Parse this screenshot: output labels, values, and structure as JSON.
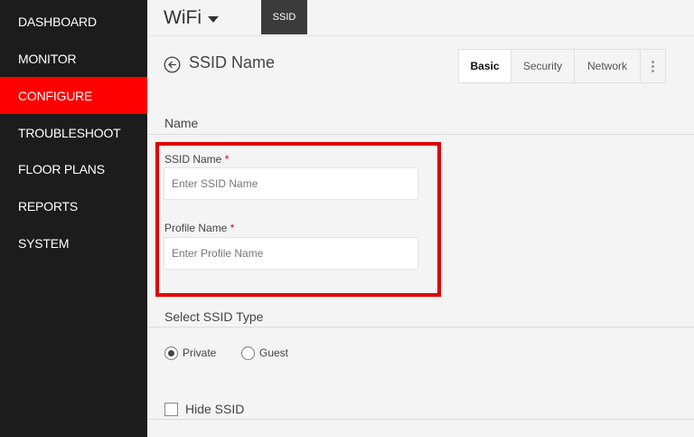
{
  "sidebar": {
    "items": [
      {
        "label": "DASHBOARD"
      },
      {
        "label": "MONITOR"
      },
      {
        "label": "CONFIGURE",
        "active": true
      },
      {
        "label": "TROUBLESHOOT"
      },
      {
        "label": "FLOOR PLANS"
      },
      {
        "label": "REPORTS"
      },
      {
        "label": "SYSTEM"
      }
    ]
  },
  "header": {
    "wifi_label": "WiFi",
    "ssid_tab_label": "SSID"
  },
  "page": {
    "title": "SSID Name",
    "back_icon": "arrow-left-circle-icon"
  },
  "tabs": [
    {
      "label": "Basic",
      "active": true
    },
    {
      "label": "Security"
    },
    {
      "label": "Network"
    }
  ],
  "name_section": {
    "title": "Name",
    "ssid_name": {
      "label": "SSID Name",
      "required_mark": "*",
      "value": "",
      "placeholder": "Enter SSID Name"
    },
    "profile_name": {
      "label": "Profile Name",
      "required_mark": "*",
      "value": "",
      "placeholder": "Enter Profile Name"
    }
  },
  "ssid_type_section": {
    "title": "Select SSID Type",
    "options": [
      {
        "label": "Private",
        "selected": true
      },
      {
        "label": "Guest",
        "selected": false
      }
    ]
  },
  "hide_ssid": {
    "label": "Hide SSID",
    "checked": false
  },
  "colors": {
    "sidebar_bg": "#1c1c1c",
    "active_nav": "#ff0000",
    "highlight_border": "#e00000",
    "ssid_tab_bg": "#3b3b3b"
  }
}
